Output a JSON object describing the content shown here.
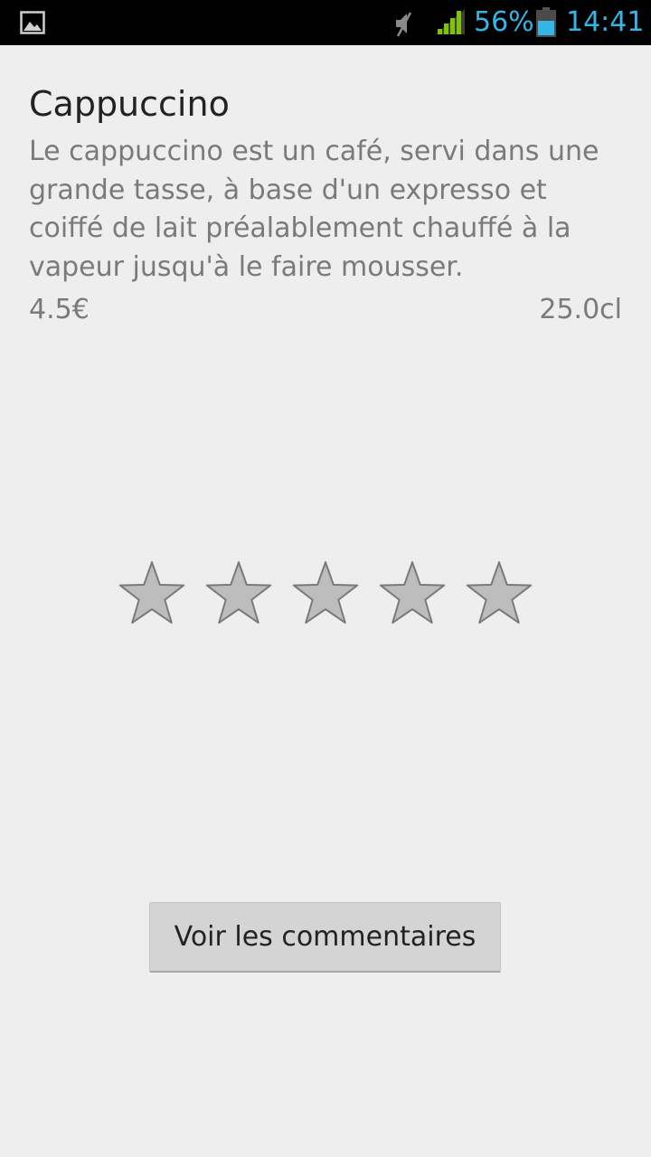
{
  "status_bar": {
    "left_icon": "image-icon",
    "mute_icon": "muted-speaker-icon",
    "signal_icon": "signal-strength-icon",
    "battery_percent": "56%",
    "battery_level": 0.56,
    "battery_icon": "battery-icon",
    "time": "14:41",
    "accent_color": "#33b5e5",
    "signal_color": "#7fc400"
  },
  "product": {
    "name": "Cappuccino",
    "description": "Le cappuccino est un café, servi dans une grande tasse, à base d'un expresso et coiffé de lait préalablement chauffé à la vapeur jusqu'à le faire mousser.",
    "price": "4.5€",
    "volume": "25.0cl"
  },
  "rating": {
    "max": 5,
    "value": 0,
    "star_icon": "star-icon",
    "star_color": "#bdbdbd"
  },
  "actions": {
    "comments_label": "Voir les commentaires"
  }
}
